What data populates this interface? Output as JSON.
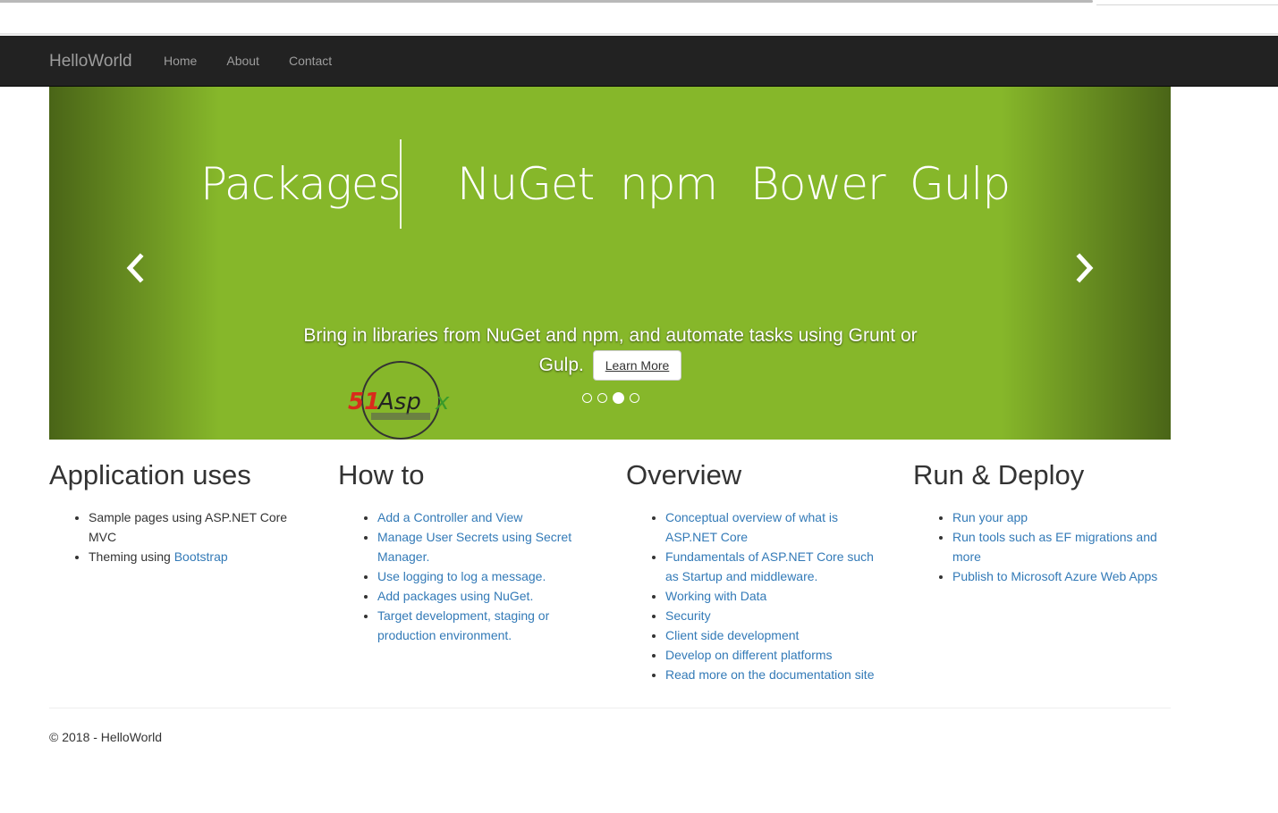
{
  "navbar": {
    "brand": "HelloWorld",
    "items": [
      {
        "label": "Home"
      },
      {
        "label": "About"
      },
      {
        "label": "Contact"
      }
    ]
  },
  "carousel": {
    "background": "#86b72a",
    "slide_words": [
      "Packages",
      "NuGet",
      "npm",
      "Bower",
      "Gulp"
    ],
    "caption": "Bring in libraries from NuGet and npm, and automate tasks using Grunt or Gulp.",
    "button_label": "Learn More",
    "indicator_count": 4,
    "active_indicator": 3,
    "prev_icon": "chevron-left-icon",
    "next_icon": "chevron-right-icon",
    "watermark": "51Aspx"
  },
  "sections": [
    {
      "title": "Application uses",
      "items": [
        {
          "text": "Sample pages using ASP.NET Core MVC"
        },
        {
          "prefix": "Theming using ",
          "link": "Bootstrap"
        }
      ]
    },
    {
      "title": "How to",
      "items": [
        {
          "link": "Add a Controller and View"
        },
        {
          "link": "Manage User Secrets using Secret Manager."
        },
        {
          "link": "Use logging to log a message."
        },
        {
          "link": "Add packages using NuGet."
        },
        {
          "link": "Target development, staging or production environment."
        }
      ]
    },
    {
      "title": "Overview",
      "items": [
        {
          "link": "Conceptual overview of what is ASP.NET Core"
        },
        {
          "link": "Fundamentals of ASP.NET Core such as Startup and middleware."
        },
        {
          "link": "Working with Data"
        },
        {
          "link": "Security"
        },
        {
          "link": "Client side development"
        },
        {
          "link": "Develop on different platforms"
        },
        {
          "link": "Read more on the documentation site"
        }
      ]
    },
    {
      "title": "Run & Deploy",
      "items": [
        {
          "link": "Run your app"
        },
        {
          "link": "Run tools such as EF migrations and more"
        },
        {
          "link": "Publish to Microsoft Azure Web Apps"
        }
      ]
    }
  ],
  "footer": {
    "text": "© 2018 - HelloWorld"
  }
}
